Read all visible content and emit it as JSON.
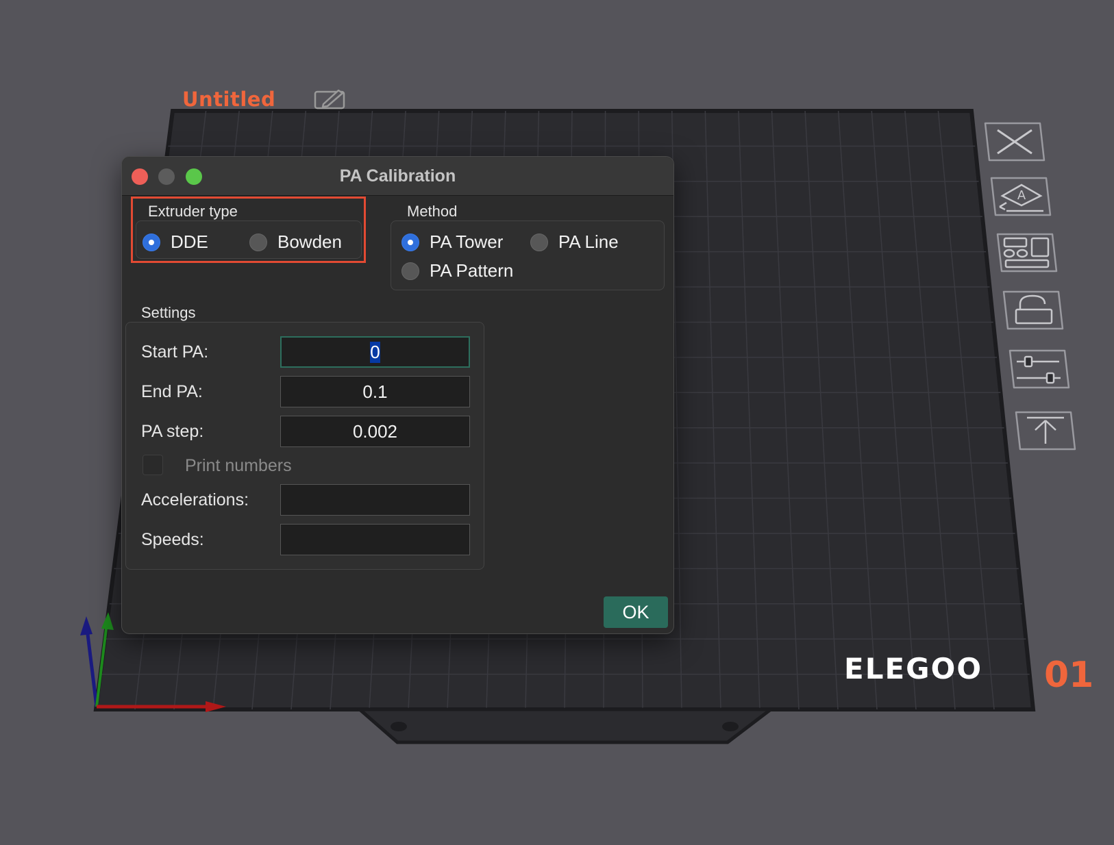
{
  "project": {
    "title": "Untitled",
    "title_color": "#f0663c",
    "edit_icon": "pencil-edit-icon"
  },
  "brand": {
    "logo_text": "ELEGOO",
    "plate_number": "01",
    "plate_number_color": "#f0663c"
  },
  "toolbar": {
    "icons": [
      "close-x-icon",
      "auto-orient-icon",
      "arrange-icon",
      "lock-icon",
      "layer-sliders-icon",
      "move-to-top-icon"
    ]
  },
  "dialog": {
    "title": "PA Calibration",
    "extruder_type": {
      "label": "Extruder type",
      "options": [
        {
          "label": "DDE",
          "selected": true
        },
        {
          "label": "Bowden",
          "selected": false
        }
      ]
    },
    "method": {
      "label": "Method",
      "options": [
        {
          "label": "PA Tower",
          "selected": true
        },
        {
          "label": "PA Line",
          "selected": false
        },
        {
          "label": "PA Pattern",
          "selected": false
        }
      ]
    },
    "settings": {
      "label": "Settings",
      "start_pa": {
        "label": "Start PA:",
        "value": "0"
      },
      "end_pa": {
        "label": "End PA:",
        "value": "0.1"
      },
      "pa_step": {
        "label": "PA step:",
        "value": "0.002"
      },
      "print_numbers": {
        "label": "Print numbers",
        "checked": false
      },
      "accelerations": {
        "label": "Accelerations:",
        "value": ""
      },
      "speeds": {
        "label": "Speeds:",
        "value": ""
      }
    },
    "ok_label": "OK"
  },
  "colors": {
    "accent": "#2f6fdc",
    "highlight": "#e34a33",
    "ok_button": "#2a6b5b"
  }
}
